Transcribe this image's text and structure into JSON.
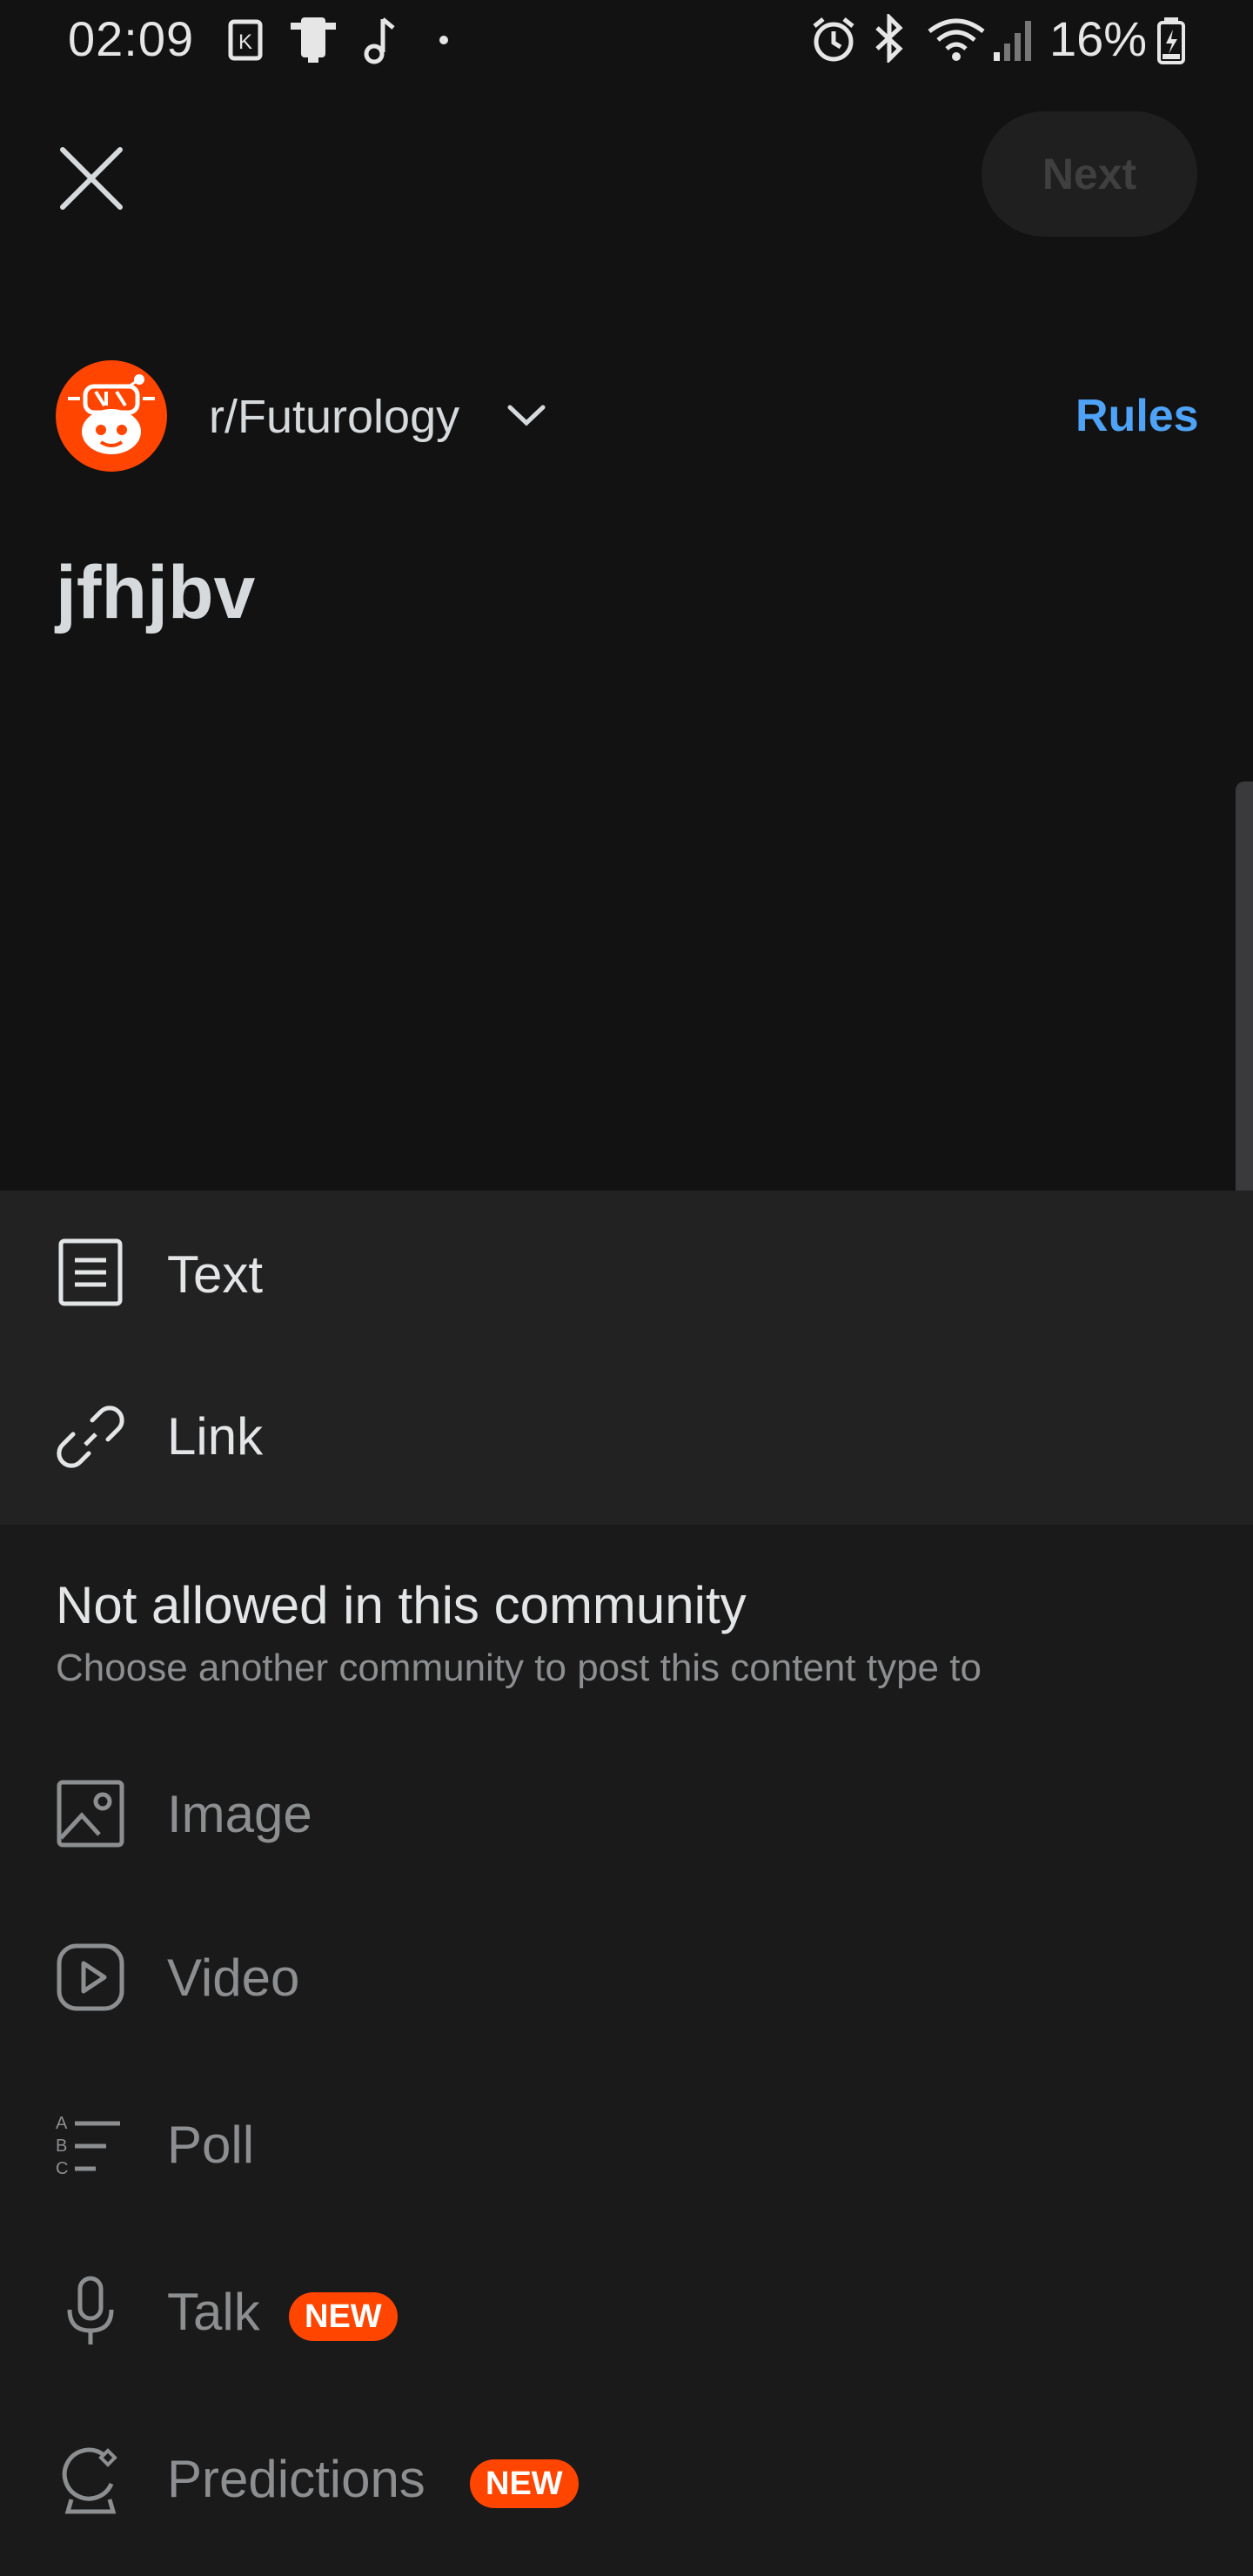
{
  "status_bar": {
    "time": "02:09",
    "battery": "16%",
    "icons": [
      "k-icon",
      "phone-icon",
      "music-note-icon",
      "dot-icon",
      "alarm-icon",
      "bluetooth-icon",
      "wifi-icon",
      "signal-icon",
      "battery-icon"
    ]
  },
  "header": {
    "close_icon": "close-icon",
    "next_label": "Next"
  },
  "community": {
    "name": "r/Futurology",
    "rules_label": "Rules",
    "avatar_color": "#ff4500"
  },
  "post": {
    "title": "jfhjbv"
  },
  "post_types": {
    "allowed": [
      {
        "label": "Text",
        "icon": "text-post-icon"
      },
      {
        "label": "Link",
        "icon": "link-icon"
      }
    ],
    "not_allowed_title": "Not allowed in this community",
    "not_allowed_subtitle": "Choose another community to post this content type to",
    "disabled": [
      {
        "label": "Image",
        "icon": "image-icon",
        "badge": ""
      },
      {
        "label": "Video",
        "icon": "video-icon",
        "badge": ""
      },
      {
        "label": "Poll",
        "icon": "poll-icon",
        "badge": ""
      },
      {
        "label": "Talk",
        "icon": "microphone-icon",
        "badge": "NEW"
      },
      {
        "label": "Predictions",
        "icon": "predictions-icon",
        "badge": "NEW"
      }
    ]
  },
  "colors": {
    "background": "#121212",
    "sheet": "#1a1a1b",
    "accent": "#4fa3f7",
    "badge": "#ff4500"
  }
}
